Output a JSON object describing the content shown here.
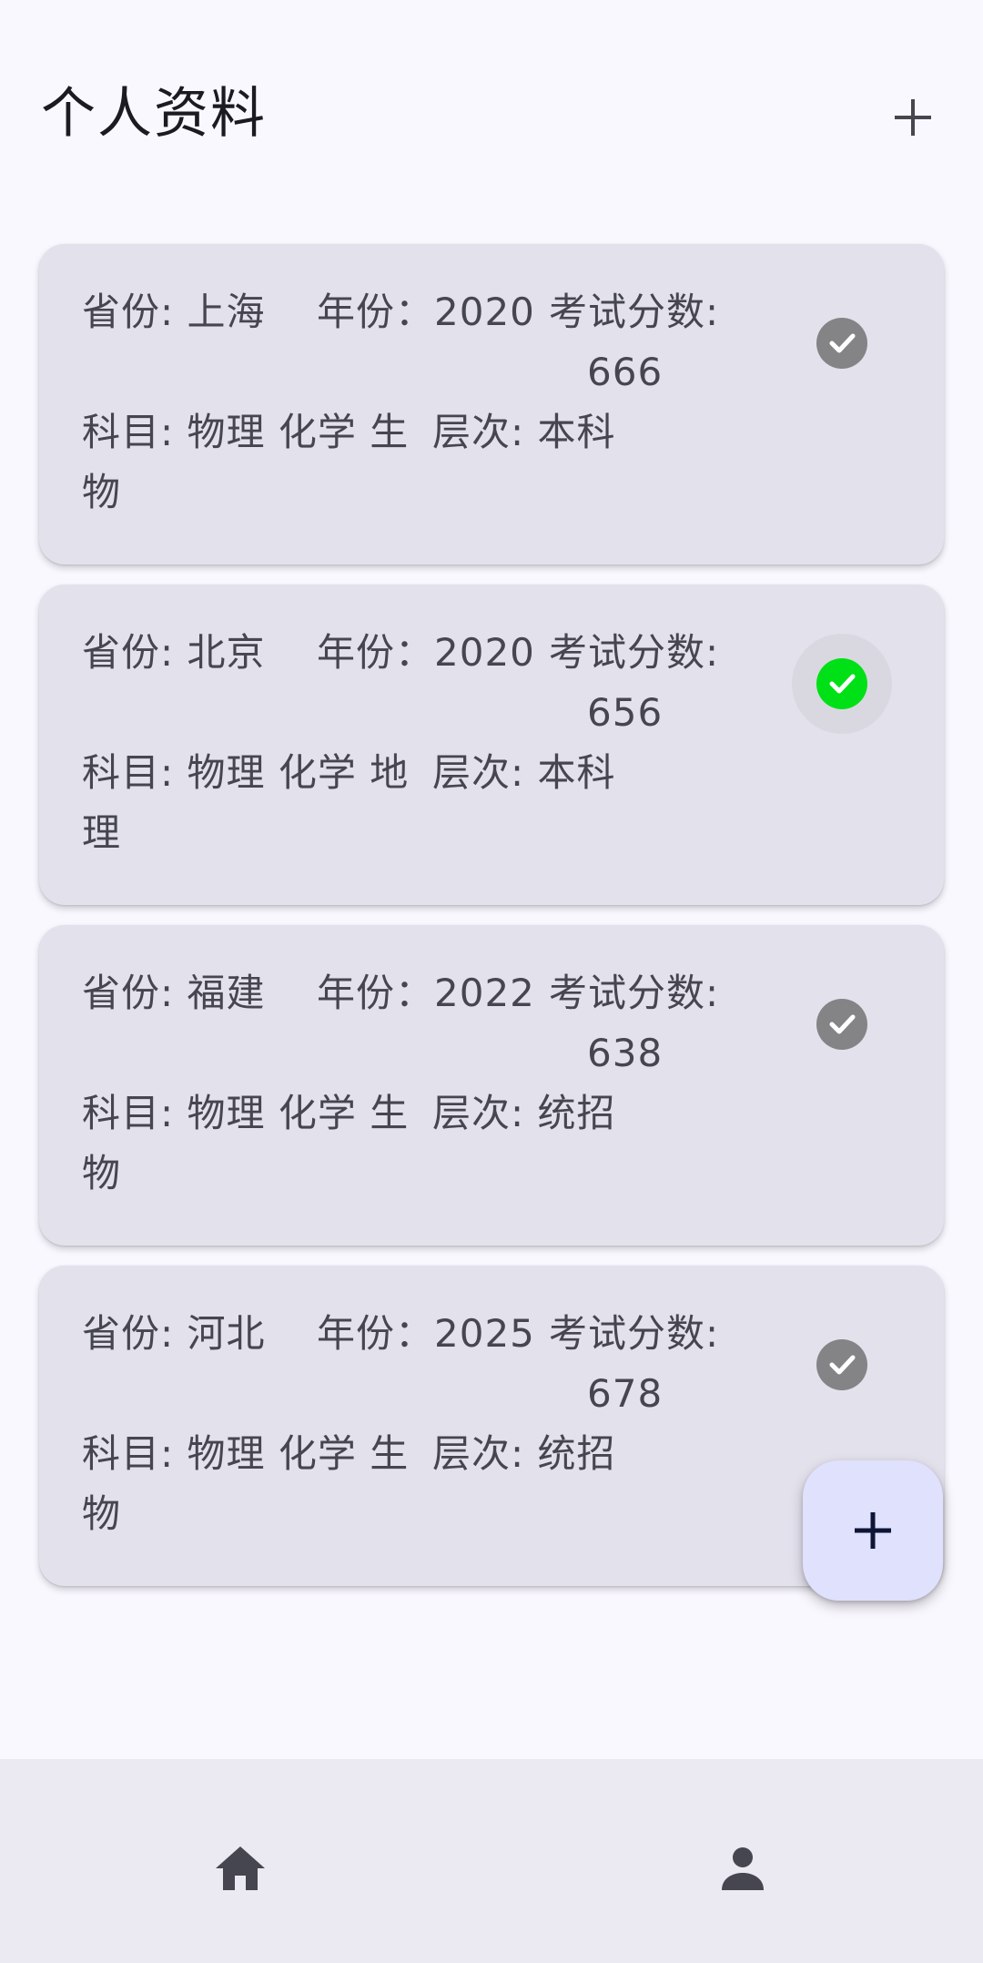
{
  "header": {
    "title": "个人资料",
    "add_icon": "plus-icon"
  },
  "cards": [
    {
      "province": "省份: 上海",
      "year": "年份：2020",
      "score_label": "考试分数:",
      "score": "666",
      "subjects": "科目: 物理 化学 生物",
      "level": "层次: 本科",
      "selected": false
    },
    {
      "province": "省份: 北京",
      "year": "年份：2020",
      "score_label": "考试分数:",
      "score": "656",
      "subjects": "科目: 物理 化学 地理",
      "level": "层次: 本科",
      "selected": true
    },
    {
      "province": "省份: 福建",
      "year": "年份：2022",
      "score_label": "考试分数:",
      "score": "638",
      "subjects": "科目: 物理 化学 生物",
      "level": "层次: 统招",
      "selected": false
    },
    {
      "province": "省份: 河北",
      "year": "年份：2025",
      "score_label": "考试分数:",
      "score": "678",
      "subjects": "科目: 物理 化学 生物",
      "level": "层次: 统招",
      "selected": false
    }
  ],
  "fab": {
    "icon": "plus-icon"
  },
  "bottom_nav": {
    "items": [
      {
        "icon": "home-icon"
      },
      {
        "icon": "person-icon"
      }
    ]
  },
  "colors": {
    "background": "#faf8ff",
    "card": "#e3e1ec",
    "check_default": "#848487",
    "check_selected": "#00e016",
    "fab": "#dfe1fd",
    "nav": "#ebeaf3"
  }
}
